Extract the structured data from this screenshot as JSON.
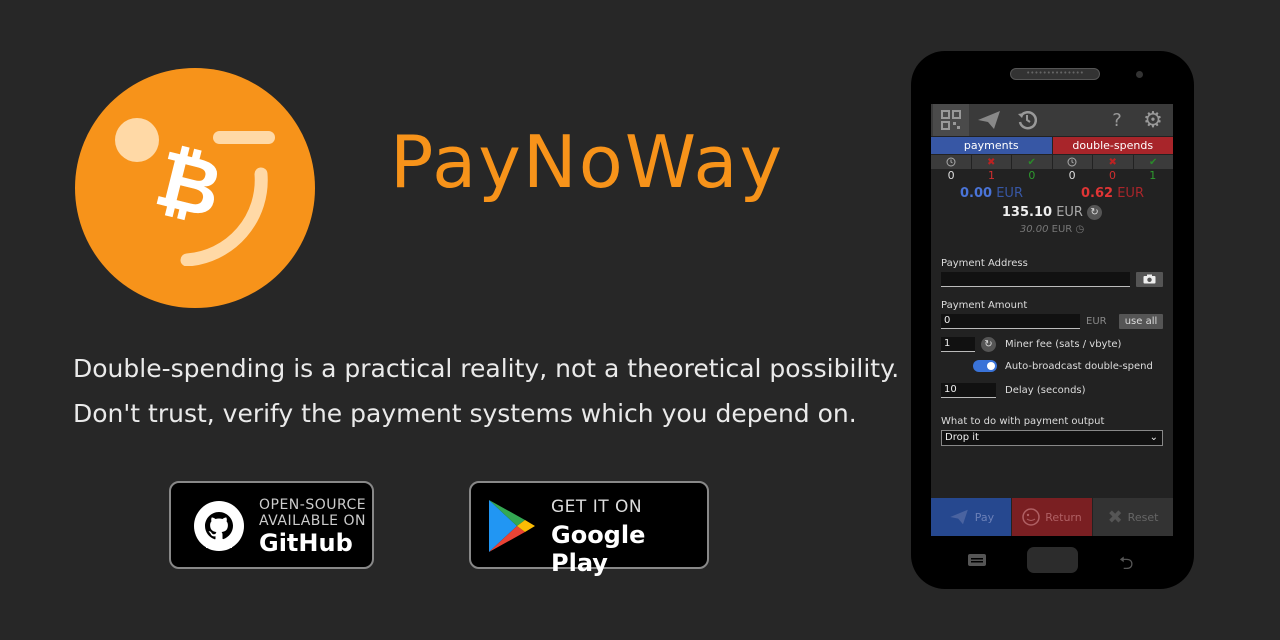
{
  "app": {
    "title": "PayNoWay",
    "logo_icon": "bitcoin-smile-logo",
    "brand_color": "#f7931a"
  },
  "taglines": [
    "Double-spending is a practical reality, not a theoretical possibility.",
    "Don't trust, verify the payment systems which you depend on."
  ],
  "badges": {
    "github": {
      "small": "OPEN-SOURCE\nAVAILABLE ON",
      "big": "GitHub",
      "icon": "github-icon"
    },
    "google_play": {
      "small": "GET IT ON",
      "big": "Google Play",
      "icon": "google-play-icon"
    }
  },
  "phone": {
    "speaker_text": "••••••••••••••",
    "toolbar": {
      "icons": [
        "qr-code-icon",
        "send-icon",
        "history-icon",
        "help-icon",
        "gear-icon"
      ],
      "help": "?"
    },
    "columns": {
      "payments": "payments",
      "double_spends": "double-spends"
    },
    "status_icons": [
      "clock",
      "✖",
      "✔",
      "clock",
      "✖",
      "✔"
    ],
    "counts": [
      "0",
      "1",
      "0",
      "0",
      "0",
      "1"
    ],
    "payments_amount": "0.00",
    "double_spends_amount": "0.62",
    "currency": "EUR",
    "balance": "135.10",
    "balance_currency": "EUR",
    "sub_amount": "30.00",
    "sub_currency": "EUR",
    "payment_address_label": "Payment Address",
    "payment_address_value": "",
    "payment_amount_label": "Payment Amount",
    "payment_amount_value": "0",
    "amount_currency": "EUR",
    "use_all": "use all",
    "miner_fee_value": "1",
    "miner_fee_label": "Miner fee (sats / vbyte)",
    "auto_broadcast_label": "Auto-broadcast double-spend",
    "auto_broadcast_on": true,
    "delay_value": "10",
    "delay_label": "Delay (seconds)",
    "output_label": "What to do with payment output",
    "output_selected": "Drop it",
    "buttons": {
      "pay": "Pay",
      "return": "Return",
      "reset": "Reset"
    },
    "colors": {
      "payments": "#3757a5",
      "double_spends": "#a8252a",
      "positive": "#2e9c2e",
      "negative": "#d02f2f"
    }
  }
}
